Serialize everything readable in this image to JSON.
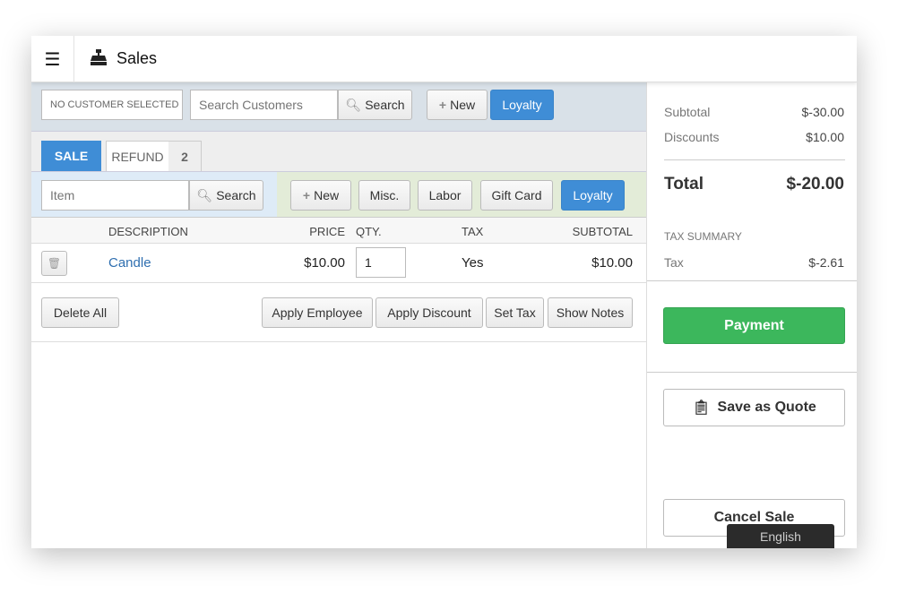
{
  "header": {
    "title": "Sales",
    "menu_icon": "hamburger-icon",
    "app_icon": "cash-register-icon"
  },
  "customer": {
    "selected": "NO CUSTOMER SELECTED",
    "search_placeholder": "Search Customers",
    "search_label": "Search",
    "new_label": "New",
    "loyalty_label": "Loyalty"
  },
  "tabs": {
    "sale": "SALE",
    "refund": "REFUND",
    "refund_count": "2"
  },
  "item_bar": {
    "placeholder": "Item",
    "search_label": "Search",
    "new_label": "New",
    "misc_label": "Misc.",
    "labor_label": "Labor",
    "gift_card_label": "Gift Card",
    "loyalty_label": "Loyalty"
  },
  "table": {
    "headers": [
      "DESCRIPTION",
      "PRICE",
      "QTY.",
      "TAX",
      "SUBTOTAL"
    ],
    "rows": [
      {
        "description": "Candle",
        "price": "$10.00",
        "qty": "1",
        "tax": "Yes",
        "subtotal": "$10.00"
      }
    ]
  },
  "actions": {
    "delete_all": "Delete All",
    "apply_employee": "Apply Employee",
    "apply_discount": "Apply Discount",
    "set_tax": "Set Tax",
    "show_notes": "Show Notes"
  },
  "summary": {
    "subtotal_label": "Subtotal",
    "subtotal": "$-30.00",
    "discounts_label": "Discounts",
    "discounts": "$10.00",
    "total_label": "Total",
    "total": "$-20.00",
    "tax_summary_label": "TAX SUMMARY",
    "tax_label": "Tax",
    "tax": "$-2.61"
  },
  "buttons": {
    "payment": "Payment",
    "save_quote": "Save as Quote",
    "cancel_sale": "Cancel Sale"
  },
  "tooltip": {
    "language": "English"
  },
  "colors": {
    "accent": "#3f8dd6",
    "payment": "#3cb75c",
    "link": "#2f6fb0"
  }
}
